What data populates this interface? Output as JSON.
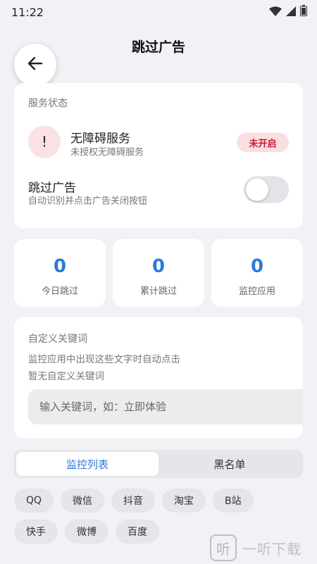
{
  "status_bar": {
    "time": "11:22",
    "icons": [
      "wifi-icon",
      "signal-icon",
      "battery-icon"
    ]
  },
  "header": {
    "title": "跳过广告",
    "back_icon": "arrow-left-icon"
  },
  "service_card": {
    "section_label": "服务状态",
    "accessibility": {
      "icon_text": "!",
      "title": "无障碍服务",
      "subtitle": "未授权无障碍服务",
      "badge": "未开启"
    },
    "skip_ads": {
      "title": "跳过广告",
      "subtitle": "自动识别并点击广告关闭按钮",
      "enabled": false
    }
  },
  "stats": [
    {
      "value": "0",
      "label": "今日跳过"
    },
    {
      "value": "0",
      "label": "累计跳过"
    },
    {
      "value": "0",
      "label": "监控应用"
    }
  ],
  "keywords": {
    "section_label": "自定义关键词",
    "description": "监控应用中出现这些文字时自动点击",
    "empty_text": "暂无自定义关键词",
    "input_placeholder": "输入关键词，如：立即体验",
    "input_value": ""
  },
  "tabs": [
    {
      "label": "监控列表",
      "active": true
    },
    {
      "label": "黑名单",
      "active": false
    }
  ],
  "apps": [
    "QQ",
    "微信",
    "抖音",
    "淘宝",
    "B站",
    "快手",
    "微博",
    "百度"
  ],
  "watermark": {
    "logo_char": "听",
    "text": "一听下载"
  },
  "colors": {
    "accent": "#2d79d6",
    "badge_bg": "#fbdde2",
    "badge_text": "#c81c2c",
    "background": "#f2f2f6"
  }
}
